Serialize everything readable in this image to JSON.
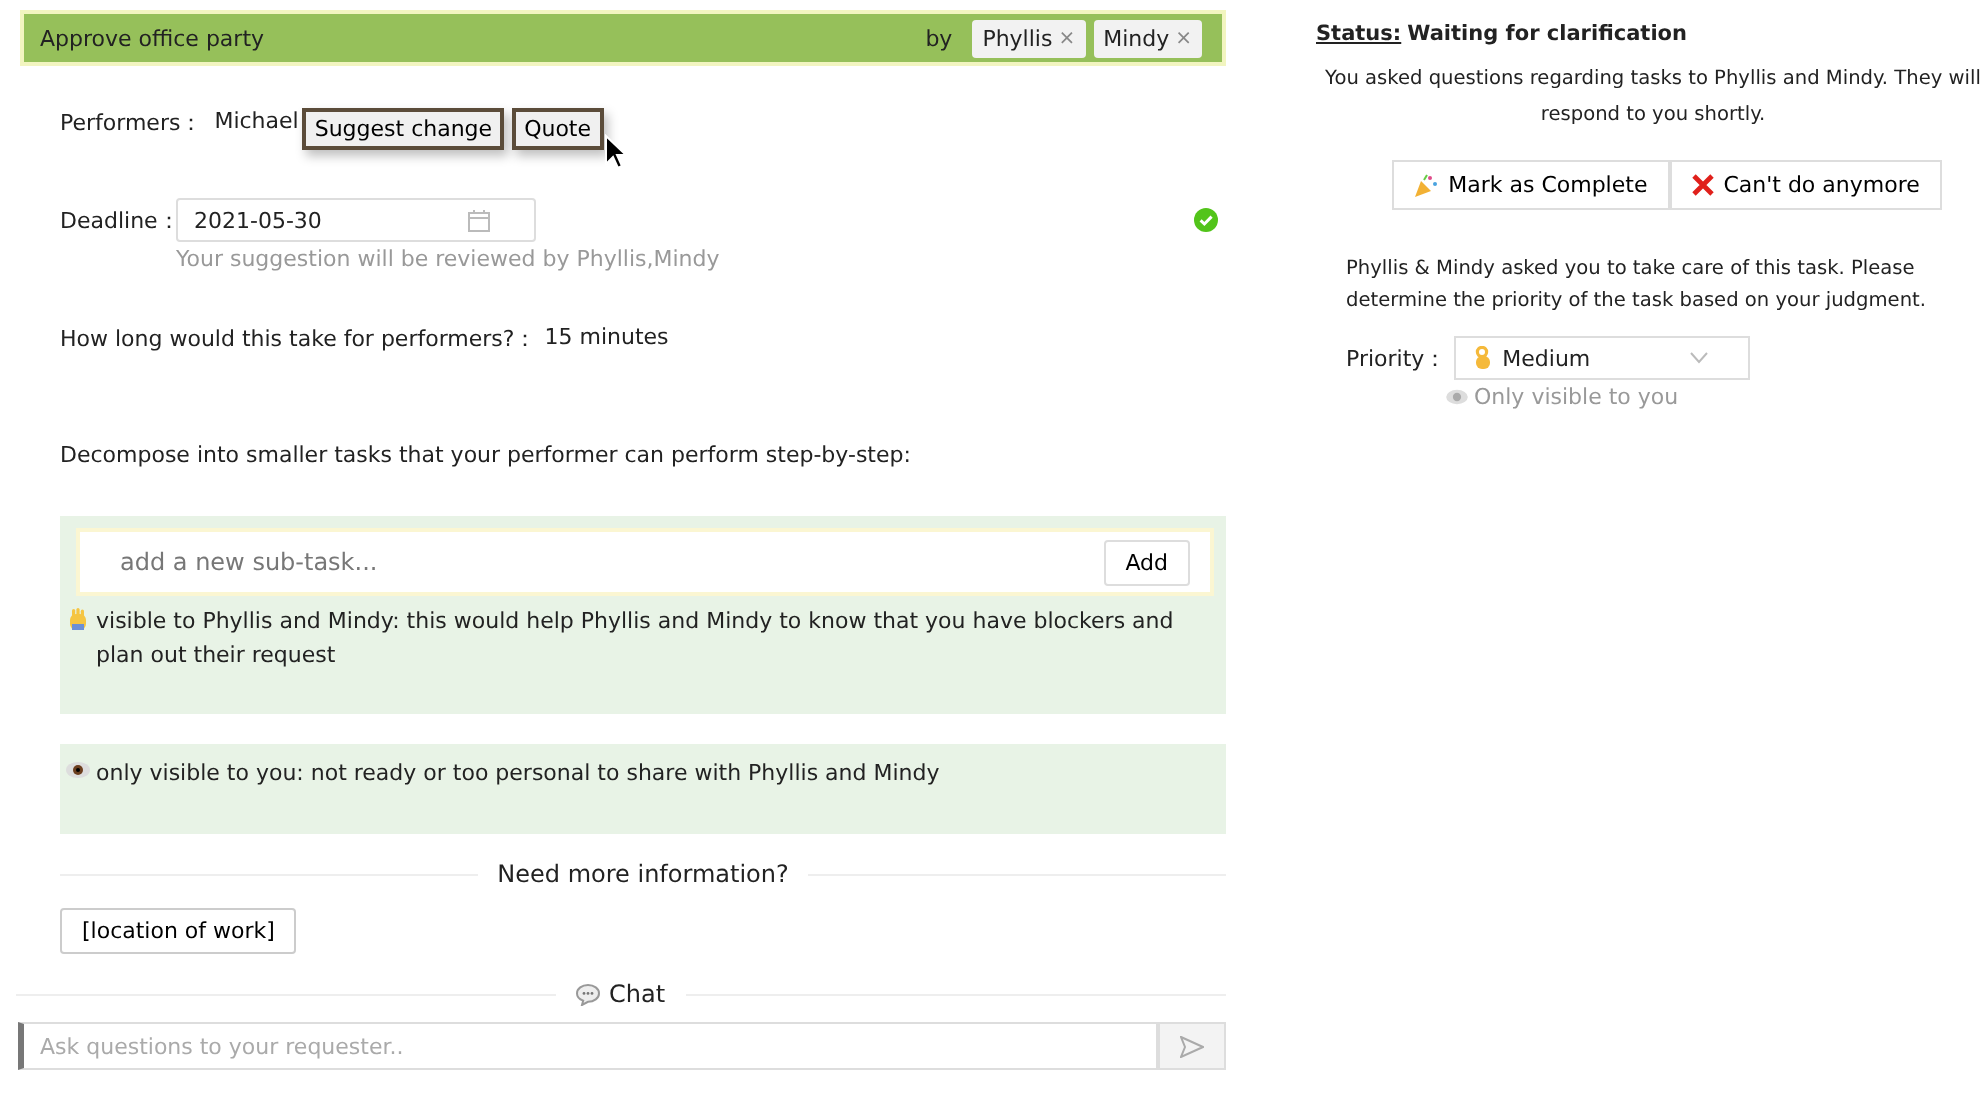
{
  "task": {
    "title": "Approve office party",
    "by_label": "by",
    "requesters": [
      {
        "name": "Phyllis",
        "remove": "×"
      },
      {
        "name": "Mindy",
        "remove": "×"
      }
    ]
  },
  "performers": {
    "label": "Performers：",
    "value": "Michael",
    "buttons": [
      "Suggest change",
      "Quote"
    ]
  },
  "deadline": {
    "label": "Deadline：",
    "value": "2021-05-30",
    "hint": "Your suggestion will be reviewed by Phyllis,Mindy",
    "confirmed": true
  },
  "duration": {
    "label": "How long would this take for performers?：",
    "value": "15 minutes"
  },
  "decompose": {
    "prompt": "Decompose into smaller tasks that your performer can perform step-by-step:",
    "subtask": {
      "placeholder": "add a new sub-task...",
      "button": "Add"
    },
    "sections": [
      {
        "kind": "shared",
        "note": "visible to Phyllis and Mindy: this would help Phyllis and Mindy to know that you have blockers and plan out their request"
      },
      {
        "kind": "private",
        "note": "only visible to you: not ready or too personal to share with Phyllis and Mindy"
      }
    ]
  },
  "more_info": {
    "heading": "Need more information?",
    "chips": [
      "[location of work]"
    ]
  },
  "chat": {
    "heading": "Chat",
    "placeholder": "Ask questions to your requester.."
  },
  "status": {
    "label": "Status:",
    "value": "Waiting for clarification",
    "message": "You asked questions regarding tasks to Phyllis and Mindy. They will respond to you shortly.",
    "actions": [
      {
        "kind": "complete",
        "label": "Mark as Complete"
      },
      {
        "kind": "cancel",
        "label": "Can't do anymore"
      }
    ]
  },
  "priority": {
    "intro": "Phyllis & Mindy asked you to take care of this task. Please determine the priority of the task based on your judgment.",
    "label": "Priority：",
    "value": "Medium",
    "note": "Only visible to you"
  }
}
